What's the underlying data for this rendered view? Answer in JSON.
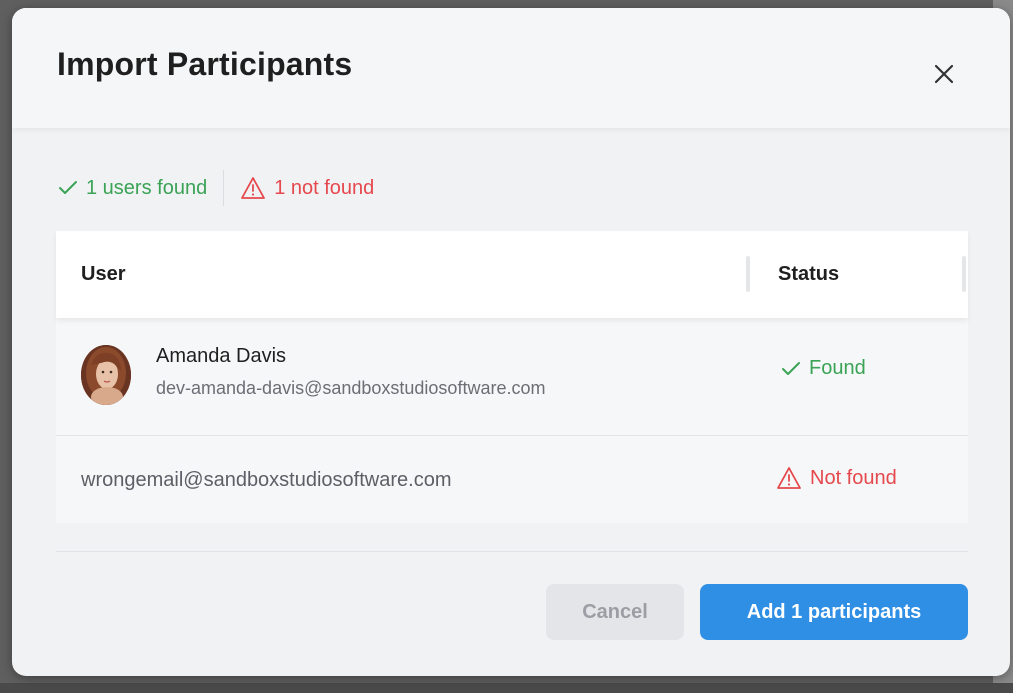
{
  "modal": {
    "title": "Import Participants",
    "close_icon": "close-icon"
  },
  "summary": {
    "found_text": "1 users found",
    "notfound_text": "1 not found",
    "found_icon": "check-icon",
    "notfound_icon": "warning-triangle-icon",
    "colors": {
      "found": "#3aa356",
      "not_found": "#e5484d"
    }
  },
  "table": {
    "columns": [
      "User",
      "Status"
    ],
    "rows": [
      {
        "name": "Amanda Davis",
        "email": "dev-amanda-davis@sandboxstudiosoftware.com",
        "status": "Found",
        "has_avatar": true
      },
      {
        "name": "",
        "email": "wrongemail@sandboxstudiosoftware.com",
        "status": "Not found",
        "has_avatar": false
      }
    ]
  },
  "footer": {
    "cancel_label": "Cancel",
    "add_label": "Add 1 participants",
    "add_color": "#2f8fe5"
  }
}
